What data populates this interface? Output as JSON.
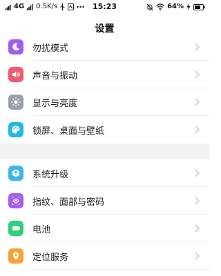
{
  "status_bar": {
    "network": "4G",
    "speed": "0.5K/s",
    "time": "15:23",
    "battery": "64%",
    "icons": [
      "signal-icon",
      "usb-icon",
      "notification-icon",
      "more-icon",
      "mute-icon",
      "wifi-icon",
      "battery-icon",
      "charging-icon"
    ]
  },
  "header": {
    "title": "设置"
  },
  "groups": [
    {
      "items": [
        {
          "label": "勿扰模式",
          "icon": "moon-icon",
          "color": "#a45cf0"
        },
        {
          "label": "声音与振动",
          "icon": "speaker-icon",
          "color": "#f25a6e"
        },
        {
          "label": "显示与亮度",
          "icon": "brightness-icon",
          "color": "#9aa0ab"
        },
        {
          "label": "锁屏、桌面与壁纸",
          "icon": "palette-icon",
          "color": "#22b8e0"
        }
      ]
    },
    {
      "items": [
        {
          "label": "系统升级",
          "icon": "system-update-icon",
          "color": "#3fb5ee"
        },
        {
          "label": "指纹、面部与密码",
          "icon": "fingerprint-icon",
          "color": "#a85cf0"
        },
        {
          "label": "电池",
          "icon": "battery-icon",
          "color": "#2fd07a"
        },
        {
          "label": "定位服务",
          "icon": "location-icon",
          "color": "#f7a23a"
        }
      ]
    }
  ],
  "colors": {
    "chevron": "#c7c7cc",
    "divider": "#ececec",
    "group_gap": "#f2f2f2"
  }
}
